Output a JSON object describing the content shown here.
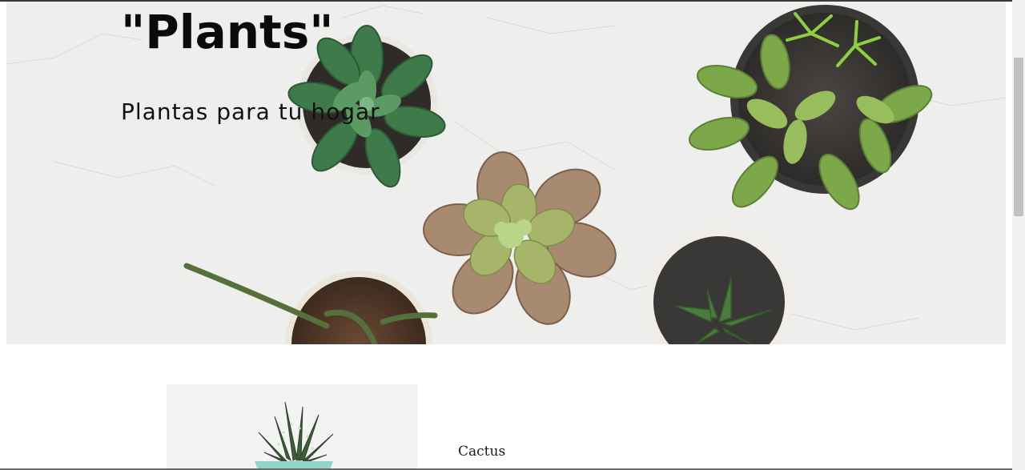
{
  "hero": {
    "title": "\"Plants\"",
    "subtitle": "Plantas para tu hogar"
  },
  "products": [
    {
      "name": "Cactus"
    }
  ],
  "colors": {
    "hero_background": "#eeeeec",
    "text": "#0a0a0a",
    "succulent_green": "#3f7a4a",
    "light_green": "#7db84c",
    "pink_succulent": "#a88a70"
  }
}
